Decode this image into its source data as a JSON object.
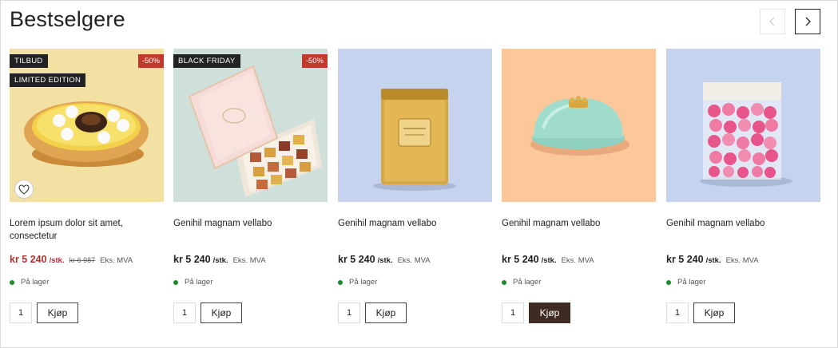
{
  "section": {
    "title": "Bestselgere"
  },
  "nav": {
    "prev_icon": "chevron-left-icon",
    "next_icon": "chevron-right-icon"
  },
  "products": [
    {
      "name": "Lorem ipsum dolor sit amet, consectetur",
      "badges": [
        "TILBUD",
        "LIMITED EDITION"
      ],
      "discount": "-50%",
      "price": "kr 5 240",
      "unit": "/stk.",
      "old_price": "kr 6 987",
      "vat": "Eks. MVA",
      "stock": "På lager",
      "qty": "1",
      "buy_label": "Kjøp",
      "bg": "#f3e1a4",
      "icon": "tart-icon",
      "favorite_icon": "heart-icon"
    },
    {
      "name": "Genihil magnam vellabo",
      "badges": [
        "BLACK FRIDAY"
      ],
      "discount": "-50%",
      "price": "kr 5 240",
      "unit": "/stk.",
      "vat": "Eks. MVA",
      "stock": "På lager",
      "qty": "1",
      "buy_label": "Kjøp",
      "bg": "#cfe0da",
      "icon": "chocolate-box-icon"
    },
    {
      "name": "Genihil magnam vellabo",
      "price": "kr 5 240",
      "unit": "/stk.",
      "vat": "Eks. MVA",
      "stock": "På lager",
      "qty": "1",
      "buy_label": "Kjøp",
      "bg": "#c5d3ee",
      "icon": "tea-tin-icon"
    },
    {
      "name": "Genihil magnam vellabo",
      "price": "kr 5 240",
      "unit": "/stk.",
      "vat": "Eks. MVA",
      "stock": "På lager",
      "qty": "1",
      "buy_label": "Kjøp",
      "bg": "#fdc79c",
      "icon": "dome-box-icon"
    },
    {
      "name": "Genihil magnam vellabo",
      "price": "kr 5 240",
      "unit": "/stk.",
      "vat": "Eks. MVA",
      "stock": "På lager",
      "qty": "1",
      "buy_label": "Kjøp",
      "bg": "#c5d3ee",
      "icon": "candy-jar-icon"
    }
  ],
  "colors": {
    "sale": "#b03030",
    "badge": "#222222",
    "discount": "#c0392b",
    "in_stock": "#1e8a2c",
    "buy_active": "#3e2b22"
  }
}
